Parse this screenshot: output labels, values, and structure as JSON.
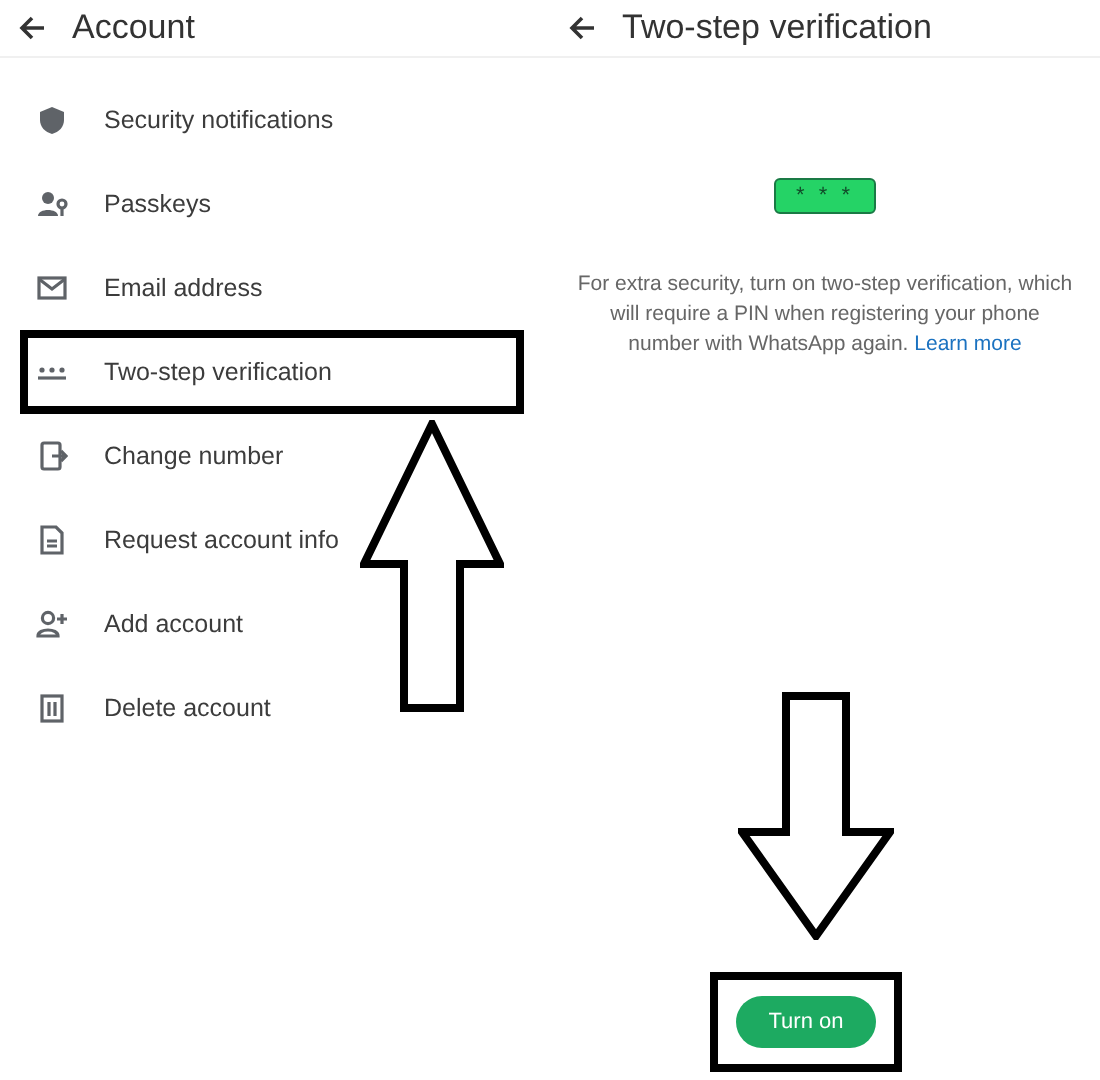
{
  "account": {
    "title": "Account",
    "items": [
      {
        "label": "Security notifications",
        "annotated": false
      },
      {
        "label": "Passkeys",
        "annotated": false
      },
      {
        "label": "Email address",
        "annotated": false
      },
      {
        "label": "Two-step verification",
        "annotated": true
      },
      {
        "label": "Change number",
        "annotated": false
      },
      {
        "label": "Request account info",
        "annotated": false
      },
      {
        "label": "Add account",
        "annotated": false
      },
      {
        "label": "Delete account",
        "annotated": false
      }
    ]
  },
  "two_step": {
    "title": "Two-step verification",
    "pin_badge": "* * *",
    "description": "For extra security, turn on two-step verification, which will require a PIN when registering your phone number with WhatsApp again.",
    "link": "Learn more",
    "button": {
      "label": "Turn on",
      "annotated": true
    }
  }
}
